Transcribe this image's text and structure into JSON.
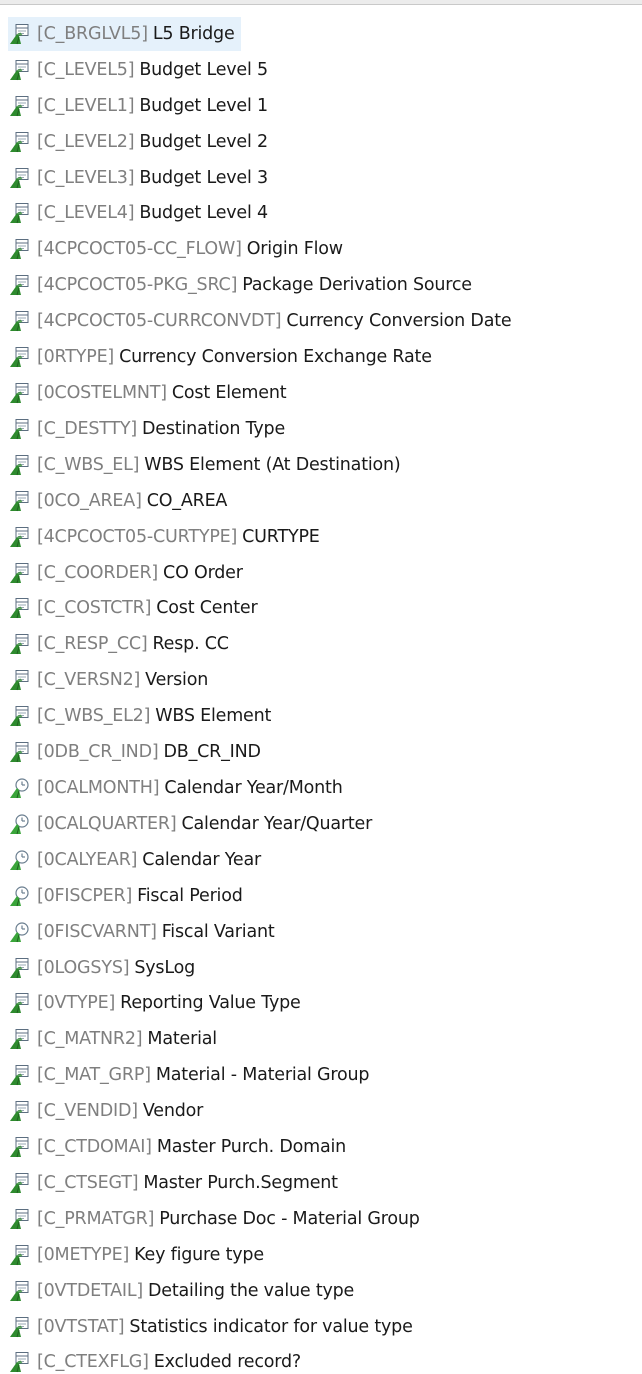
{
  "colors": {
    "selection_background": "#e5f1fb",
    "technical_name": "#7f7f7f",
    "description": "#1a1a1a",
    "characteristic_icon": "#2e8b2e",
    "time_characteristic_icon": "#3aa53a"
  },
  "tree": {
    "items": [
      {
        "tech": "[C_BRGLVL5]",
        "desc": "L5 Bridge",
        "icon": "characteristic-icon",
        "selected": true
      },
      {
        "tech": "[C_LEVEL5]",
        "desc": "Budget Level 5",
        "icon": "characteristic-icon"
      },
      {
        "tech": "[C_LEVEL1]",
        "desc": "Budget Level 1",
        "icon": "characteristic-icon"
      },
      {
        "tech": "[C_LEVEL2]",
        "desc": "Budget Level 2",
        "icon": "characteristic-icon"
      },
      {
        "tech": "[C_LEVEL3]",
        "desc": "Budget Level 3",
        "icon": "characteristic-icon"
      },
      {
        "tech": "[C_LEVEL4]",
        "desc": "Budget Level 4",
        "icon": "characteristic-icon"
      },
      {
        "tech": "[4CPCOCT05-CC_FLOW]",
        "desc": "Origin Flow",
        "icon": "characteristic-icon"
      },
      {
        "tech": "[4CPCOCT05-PKG_SRC]",
        "desc": "Package Derivation Source",
        "icon": "characteristic-icon"
      },
      {
        "tech": "[4CPCOCT05-CURRCONVDT]",
        "desc": "Currency Conversion Date",
        "icon": "characteristic-icon"
      },
      {
        "tech": "[0RTYPE]",
        "desc": "Currency Conversion Exchange Rate",
        "icon": "characteristic-icon"
      },
      {
        "tech": "[0COSTELMNT]",
        "desc": "Cost Element",
        "icon": "characteristic-icon"
      },
      {
        "tech": "[C_DESTTY]",
        "desc": "Destination Type",
        "icon": "characteristic-icon"
      },
      {
        "tech": "[C_WBS_EL]",
        "desc": "WBS Element (At Destination)",
        "icon": "characteristic-icon"
      },
      {
        "tech": "[0CO_AREA]",
        "desc": "CO_AREA",
        "icon": "characteristic-icon"
      },
      {
        "tech": "[4CPCOCT05-CURTYPE]",
        "desc": "CURTYPE",
        "icon": "characteristic-icon"
      },
      {
        "tech": "[C_COORDER]",
        "desc": "CO Order",
        "icon": "characteristic-icon"
      },
      {
        "tech": "[C_COSTCTR]",
        "desc": "Cost Center",
        "icon": "characteristic-icon"
      },
      {
        "tech": "[C_RESP_CC]",
        "desc": "Resp. CC",
        "icon": "characteristic-icon"
      },
      {
        "tech": "[C_VERSN2]",
        "desc": "Version",
        "icon": "characteristic-icon"
      },
      {
        "tech": "[C_WBS_EL2]",
        "desc": "WBS Element",
        "icon": "characteristic-icon"
      },
      {
        "tech": "[0DB_CR_IND]",
        "desc": "DB_CR_IND",
        "icon": "characteristic-icon"
      },
      {
        "tech": "[0CALMONTH]",
        "desc": "Calendar Year/Month",
        "icon": "time-characteristic-icon"
      },
      {
        "tech": "[0CALQUARTER]",
        "desc": "Calendar Year/Quarter",
        "icon": "time-characteristic-icon"
      },
      {
        "tech": "[0CALYEAR]",
        "desc": "Calendar Year",
        "icon": "time-characteristic-icon"
      },
      {
        "tech": "[0FISCPER]",
        "desc": "Fiscal Period",
        "icon": "time-characteristic-icon"
      },
      {
        "tech": "[0FISCVARNT]",
        "desc": "Fiscal Variant",
        "icon": "time-characteristic-icon"
      },
      {
        "tech": "[0LOGSYS]",
        "desc": "SysLog",
        "icon": "characteristic-icon"
      },
      {
        "tech": "[0VTYPE]",
        "desc": "Reporting Value Type",
        "icon": "characteristic-icon"
      },
      {
        "tech": "[C_MATNR2]",
        "desc": "Material",
        "icon": "characteristic-icon"
      },
      {
        "tech": "[C_MAT_GRP]",
        "desc": "Material - Material Group",
        "icon": "characteristic-icon"
      },
      {
        "tech": "[C_VENDID]",
        "desc": "Vendor",
        "icon": "characteristic-icon"
      },
      {
        "tech": "[C_CTDOMAI]",
        "desc": "Master Purch. Domain",
        "icon": "characteristic-icon"
      },
      {
        "tech": "[C_CTSEGT]",
        "desc": "Master Purch.Segment",
        "icon": "characteristic-icon"
      },
      {
        "tech": "[C_PRMATGR]",
        "desc": "Purchase Doc - Material Group",
        "icon": "characteristic-icon"
      },
      {
        "tech": "[0METYPE]",
        "desc": "Key figure type",
        "icon": "characteristic-icon"
      },
      {
        "tech": "[0VTDETAIL]",
        "desc": "Detailing the value type",
        "icon": "characteristic-icon"
      },
      {
        "tech": "[0VTSTAT]",
        "desc": "Statistics indicator for value type",
        "icon": "characteristic-icon"
      },
      {
        "tech": "[C_CTEXFLG]",
        "desc": "Excluded record?",
        "icon": "characteristic-icon"
      }
    ]
  }
}
